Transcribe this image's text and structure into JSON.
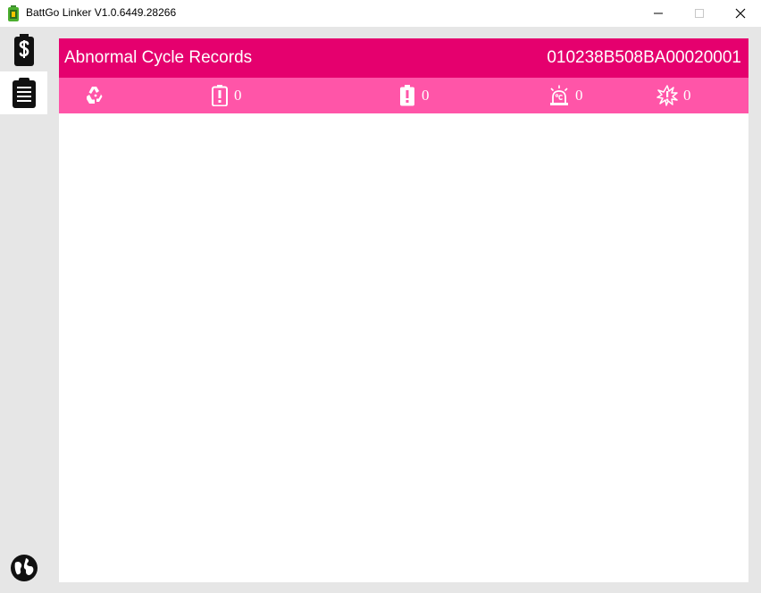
{
  "window": {
    "title": "BattGo Linker  V1.0.6449.28266",
    "icons": [
      "app-icon",
      "minimize-icon",
      "maximize-icon",
      "close-icon"
    ]
  },
  "sidebar": {
    "items": [
      {
        "icon": "battery-s-icon",
        "active": false
      },
      {
        "icon": "clipboard-list-icon",
        "active": true
      },
      {
        "icon": "globe-icon",
        "active": false
      }
    ]
  },
  "header": {
    "title": "Abnormal Cycle Records",
    "serial": "010238B508BA00020001"
  },
  "stats": [
    {
      "icon": "recycle-icon"
    },
    {
      "icon": "battery-warning-outline-icon",
      "count": "0"
    },
    {
      "icon": "battery-warning-filled-icon",
      "count": "0"
    },
    {
      "icon": "temperature-alarm-icon",
      "count": "0"
    },
    {
      "icon": "burst-warning-icon",
      "count": "0"
    }
  ],
  "colors": {
    "header": "#e5006e",
    "statbar": "#ff55a8",
    "background": "#e6e6e6"
  }
}
